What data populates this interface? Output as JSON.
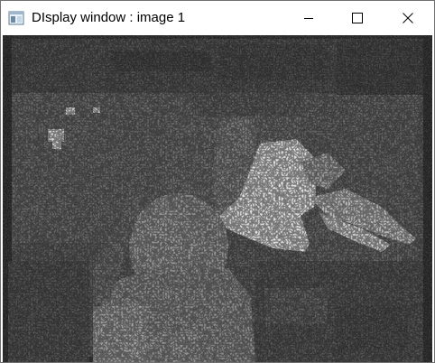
{
  "window": {
    "title": "DIsplay window : image 1",
    "icon": "app-window-icon",
    "controls": {
      "minimize": {
        "icon": "minimize-icon"
      },
      "maximize": {
        "icon": "maximize-icon"
      },
      "close": {
        "icon": "close-icon"
      }
    }
  },
  "image": {
    "name": "image 1",
    "kind": "grayscale depth map"
  },
  "colors": {
    "titlebar_background": "#ffffff",
    "title_text": "#000000",
    "window_border": "#707070"
  }
}
